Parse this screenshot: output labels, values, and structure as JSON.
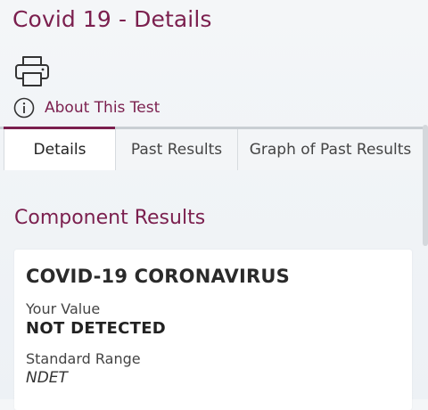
{
  "page": {
    "title": "Covid 19 - Details"
  },
  "toolbar": {
    "print_icon": "printer-icon",
    "about_icon": "info-icon",
    "about_label": "About This Test"
  },
  "tabs": [
    {
      "label": "Details",
      "active": true
    },
    {
      "label": "Past Results",
      "active": false
    },
    {
      "label": "Graph of Past Results",
      "active": false
    }
  ],
  "section": {
    "heading": "Component Results"
  },
  "component": {
    "name": "COVID-19 CORONAVIRUS",
    "value_label": "Your Value",
    "value": "NOT DETECTED",
    "range_label": "Standard Range",
    "range": "NDET"
  },
  "colors": {
    "brand": "#7b1f4e",
    "background": "#f1f4f7",
    "card": "#ffffff"
  }
}
